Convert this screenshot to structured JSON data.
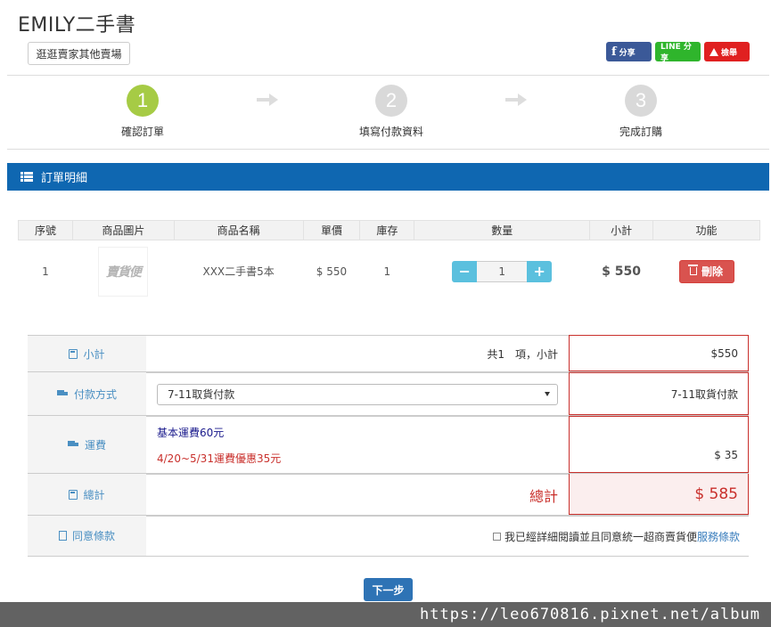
{
  "shop": {
    "title": "EMILY二手書",
    "other_stores_button": "逛逛賣家其他賣場",
    "share": {
      "fb_label": "分享",
      "line_label": "LINE 分享",
      "report_label": "檢舉"
    }
  },
  "steps": [
    {
      "num": "1",
      "label": "確認訂單",
      "active": true
    },
    {
      "num": "2",
      "label": "填寫付款資料",
      "active": false
    },
    {
      "num": "3",
      "label": "完成訂購",
      "active": false
    }
  ],
  "section": {
    "title": "訂單明細"
  },
  "table": {
    "headers": [
      "序號",
      "商品圖片",
      "商品名稱",
      "單價",
      "庫存",
      "數量",
      "小計",
      "功能"
    ],
    "rows": [
      {
        "index": "1",
        "image_text": "賣貨便",
        "name": "XXX二手書5本",
        "price": "$ 550",
        "stock": "1",
        "qty": "1",
        "subtotal": "$ 550",
        "action": "刪除"
      }
    ]
  },
  "summary": {
    "subtotal": {
      "label": "小計",
      "text": "共1　項，小計",
      "value": "$550"
    },
    "payment": {
      "label": "付款方式",
      "selected": "7-11取貨付款",
      "value": "7-11取貨付款"
    },
    "shipping": {
      "label": "運費",
      "base": "基本運費60元",
      "promo": "4/20~5/31運費優惠35元",
      "value": "$ 35"
    },
    "total": {
      "label": "總計",
      "text": "總計",
      "value": "$ 585"
    },
    "terms": {
      "label": "同意條款",
      "text": "我已經詳細閱讀並且同意統一超商賣貨便",
      "link": "服務條款"
    }
  },
  "next_button": "下一步",
  "watermark": "https://leo670816.pixnet.net/album",
  "colors": {
    "primary": "#0f67b1",
    "step_active": "#a6cb45",
    "danger": "#d9534f",
    "qty": "#5bc0de",
    "total_red": "#c9302c"
  }
}
